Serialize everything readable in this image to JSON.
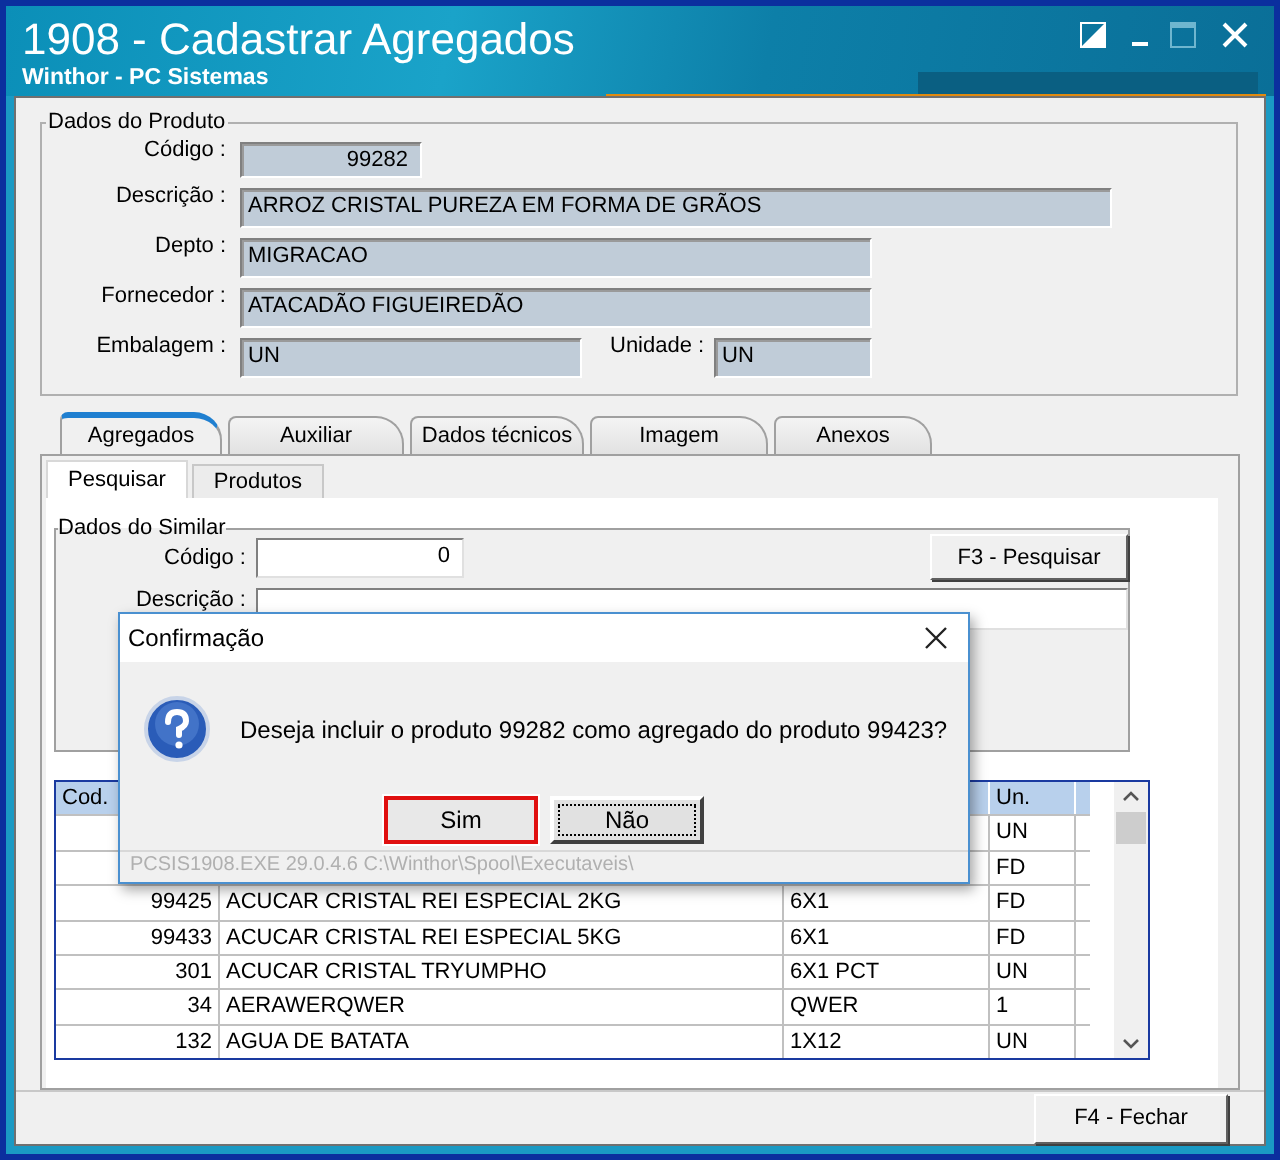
{
  "window": {
    "title": "1908 - Cadastrar Agregados",
    "subtitle": "Winthor - PC Sistemas"
  },
  "produto": {
    "legend": "Dados do Produto",
    "fields": [
      {
        "label": "Código :",
        "value": "99282",
        "kind": "number"
      },
      {
        "label": "Descrição :",
        "value": "ARROZ  CRISTAL PUREZA EM FORMA DE GRÃOS",
        "kind": "wide"
      },
      {
        "label": "Depto :",
        "value": "MIGRACAO",
        "kind": "medium"
      },
      {
        "label": "Fornecedor :",
        "value": "ATACADÃO FIGUEIREDÃO",
        "kind": "medium"
      }
    ],
    "embalagem": {
      "label": "Embalagem :",
      "value": "UN"
    },
    "unidade": {
      "label": "Unidade :",
      "value": "UN"
    }
  },
  "tabs": [
    {
      "label": "Agregados",
      "selected": true
    },
    {
      "label": "Auxiliar",
      "selected": false
    },
    {
      "label": "Dados técnicos",
      "selected": false
    },
    {
      "label": "Imagem",
      "selected": false
    },
    {
      "label": "Anexos",
      "selected": false
    }
  ],
  "subtabs": [
    {
      "label": "Pesquisar",
      "selected": true
    },
    {
      "label": "Produtos",
      "selected": false
    }
  ],
  "similar": {
    "legend": "Dados do Similar",
    "codigo_label": "Código :",
    "codigo_value": "0",
    "search_button": "F3 - Pesquisar",
    "descricao_label": "Descrição :"
  },
  "table": {
    "columns": [
      {
        "label": "Cod."
      },
      {},
      {},
      {
        "label": "Un."
      }
    ],
    "rows": [
      {
        "un": "UN"
      },
      {
        "un": "FD"
      },
      {
        "cod": "99425",
        "descricao": "ACUCAR CRISTAL REI ESPECIAL 2KG",
        "column_3": "6X1",
        "un": "FD"
      },
      {
        "cod": "99433",
        "descricao": "ACUCAR CRISTAL REI ESPECIAL 5KG",
        "column_3": "6X1",
        "un": "FD"
      },
      {
        "cod": "301",
        "descricao": "ACUCAR CRISTAL TRYUMPHO",
        "column_3": "6X1 PCT",
        "un": "UN"
      },
      {
        "cod": "34",
        "descricao": "AERAWERQWER",
        "column_3": "QWER",
        "un": "1"
      },
      {
        "cod": "132",
        "descricao": "AGUA DE BATATA",
        "column_3": "1X12",
        "un": "UN"
      }
    ]
  },
  "close_button": "F4 - Fechar",
  "dialog": {
    "title": "Confirmação",
    "message": "Deseja incluir o produto 99282 como agregado do produto 99423?",
    "buttons": [
      {
        "label": "Sim",
        "highlighted": true
      },
      {
        "label": "Não",
        "highlighted": false
      }
    ],
    "footer": "PCSIS1908.EXE 29.0.4.6 C:\\Winthor\\Spool\\Executaveis\\"
  }
}
